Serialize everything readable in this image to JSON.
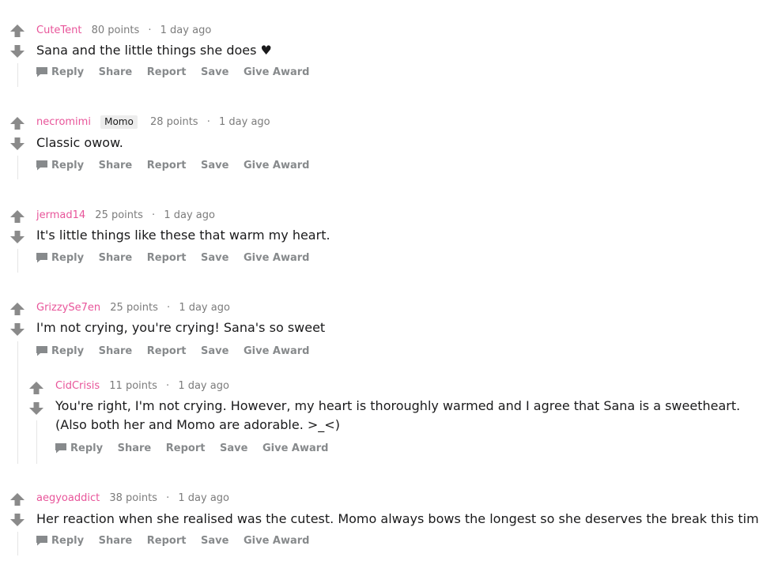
{
  "colors": {
    "author": "#e8559a",
    "meta": "#7c7c7c",
    "action": "#878a8c",
    "vote": "#8a8a8a"
  },
  "icons": {
    "upvote": "arrow-up-icon",
    "downvote": "arrow-down-icon",
    "reply": "speech-bubble-icon"
  },
  "actions": {
    "reply": "Reply",
    "share": "Share",
    "report": "Report",
    "save": "Save",
    "award": "Give Award"
  },
  "comments": [
    {
      "author": "CuteTent",
      "points": "80 points",
      "sep": "·",
      "time": "1 day ago",
      "text": "Sana and the little things she does ♥"
    },
    {
      "author": "necromimi",
      "flair": "Momo",
      "points": "28 points",
      "sep": "·",
      "time": "1 day ago",
      "text": "Classic owow."
    },
    {
      "author": "jermad14",
      "points": "25 points",
      "sep": "·",
      "time": "1 day ago",
      "text": "It's little things like these that warm my heart."
    },
    {
      "author": "GrizzySe7en",
      "points": "25 points",
      "sep": "·",
      "time": "1 day ago",
      "text": "I'm not crying, you're crying! Sana's so sweet"
    },
    {
      "author": "CidCrisis",
      "points": "11 points",
      "sep": "·",
      "time": "1 day ago",
      "text": "You're right, I'm not crying. However, my heart is thoroughly warmed and I agree that Sana is a sweetheart. (Also both her and Momo are adorable. >_<)"
    },
    {
      "author": "aegyoaddict",
      "points": "38 points",
      "sep": "·",
      "time": "1 day ago",
      "text": "Her reaction when she realised was the cutest. Momo always bows the longest so she deserves the break this time. :P"
    }
  ]
}
